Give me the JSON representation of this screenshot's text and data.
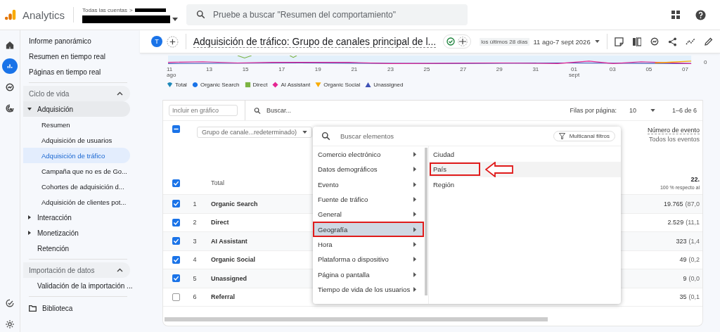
{
  "app": {
    "name": "Analytics"
  },
  "breadcrumb": {
    "root": "Todas las cuentas",
    "separator": ">"
  },
  "search": {
    "placeholder": "Pruebe a buscar \"Resumen del comportamiento\""
  },
  "rail": [
    {
      "selected": false
    },
    {
      "selected": true
    },
    {
      "selected": false
    },
    {
      "selected": false
    }
  ],
  "sidebar": {
    "items": [
      {
        "label": "Informe panorámico",
        "selected": false
      },
      {
        "label": "Resumen en tiempo real",
        "selected": false
      },
      {
        "label": "Páginas en tiempo real",
        "selected": false
      }
    ],
    "sections": [
      {
        "title": "Ciclo de vida",
        "expanded": true,
        "children": [
          {
            "label": "Adquisición",
            "kind": "group",
            "expanded": true,
            "children": [
              {
                "label": "Resumen",
                "selected": false
              },
              {
                "label": "Adquisición de usuarios",
                "selected": false
              },
              {
                "label": "Adquisición de tráfico",
                "selected": true
              },
              {
                "label": "Campaña que no es de Go...",
                "selected": false
              },
              {
                "label": "Cohortes de adquisición d...",
                "selected": false
              },
              {
                "label": "Adquisición de clientes pot...",
                "selected": false
              }
            ]
          },
          {
            "label": "Interacción",
            "kind": "group",
            "expanded": false
          },
          {
            "label": "Monetización",
            "kind": "group",
            "expanded": false
          },
          {
            "label": "Retención",
            "kind": "link",
            "selected": false
          }
        ]
      },
      {
        "title": "Importación de datos",
        "expanded": true,
        "children": [
          {
            "label": "Validación de la importación ...",
            "kind": "link",
            "selected": false
          }
        ]
      }
    ],
    "library": "Biblioteca"
  },
  "report": {
    "avatar": "T",
    "title": "Adquisición de tráfico: Grupo de canales principal de l...",
    "date_label": "los últimos 28 días",
    "date_range": "11 ago-7 sept 2026"
  },
  "chart": {
    "y_tick": "0",
    "x_ticks": [
      {
        "label": "11",
        "sub": "ago"
      },
      {
        "label": "13"
      },
      {
        "label": "15"
      },
      {
        "label": "17"
      },
      {
        "label": "19"
      },
      {
        "label": "21"
      },
      {
        "label": "23"
      },
      {
        "label": "25"
      },
      {
        "label": "27"
      },
      {
        "label": "29"
      },
      {
        "label": "31"
      },
      {
        "label": "01",
        "sub": "sept"
      },
      {
        "label": "03"
      },
      {
        "label": "05"
      },
      {
        "label": "07"
      }
    ],
    "legend": [
      {
        "label": "Total",
        "kind": "drop",
        "color": "#1e88b8"
      },
      {
        "label": "Organic Search",
        "kind": "circle",
        "color": "#1a73e8"
      },
      {
        "label": "Direct",
        "kind": "square",
        "color": "#7cb342"
      },
      {
        "label": "AI Assistant",
        "kind": "diamond",
        "color": "#e52592"
      },
      {
        "label": "Organic Social",
        "kind": "down",
        "color": "#f9ab00"
      },
      {
        "label": "Unassigned",
        "kind": "up",
        "color": "#3f51b5"
      }
    ]
  },
  "table": {
    "include_placeholder": "Incluir en gráfico",
    "search_placeholder": "Buscar...",
    "rows_per_page_label": "Filas por página:",
    "rows_per_page": "10",
    "range": "1–6 de 6",
    "select_all": {
      "indeterminate": true
    },
    "dimension": "Grupo de canale...redeterminado)",
    "metric": {
      "title": "Número de evento",
      "subtitle": "Todos los eventos"
    },
    "total": {
      "label": "Total",
      "checked": true,
      "value": "22.",
      "share": "100 % respecto al"
    },
    "rows": [
      {
        "rank": "1",
        "name": "Organic Search",
        "checked": true,
        "value": "19.765",
        "pct": "(87,0"
      },
      {
        "rank": "2",
        "name": "Direct",
        "checked": true,
        "value": "2.529",
        "pct": "(11,1"
      },
      {
        "rank": "3",
        "name": "AI Assistant",
        "checked": true,
        "value": "323",
        "pct": "(1,4"
      },
      {
        "rank": "4",
        "name": "Organic Social",
        "checked": true,
        "value": "49",
        "pct": "(0,2"
      },
      {
        "rank": "5",
        "name": "Unassigned",
        "checked": true,
        "value": "9",
        "pct": "(0,0"
      },
      {
        "rank": "6",
        "name": "Referral",
        "checked": false,
        "value": "35",
        "pct": "(0,1"
      }
    ]
  },
  "menu": {
    "search_placeholder": "Buscar elementos",
    "filter_button": "Multicanal filtros",
    "categories": [
      {
        "label": "Comercio electrónico",
        "selected": false,
        "highlighted": false
      },
      {
        "label": "Datos demográficos",
        "selected": false,
        "highlighted": false
      },
      {
        "label": "Evento",
        "selected": false,
        "highlighted": false
      },
      {
        "label": "Fuente de tráfico",
        "selected": false,
        "highlighted": false
      },
      {
        "label": "General",
        "selected": false,
        "highlighted": false
      },
      {
        "label": "Geografía",
        "selected": true,
        "highlighted": true
      },
      {
        "label": "Hora",
        "selected": false,
        "highlighted": false
      },
      {
        "label": "Plataforma o dispositivo",
        "selected": false,
        "highlighted": false
      },
      {
        "label": "Página o pantalla",
        "selected": false,
        "highlighted": false
      },
      {
        "label": "Tiempo de vida de los usuarios",
        "selected": false,
        "highlighted": false
      }
    ],
    "options": [
      {
        "label": "Ciudad",
        "hovered": false,
        "highlighted": false
      },
      {
        "label": "País",
        "hovered": true,
        "highlighted": true
      },
      {
        "label": "Región",
        "hovered": false,
        "highlighted": false
      }
    ]
  }
}
